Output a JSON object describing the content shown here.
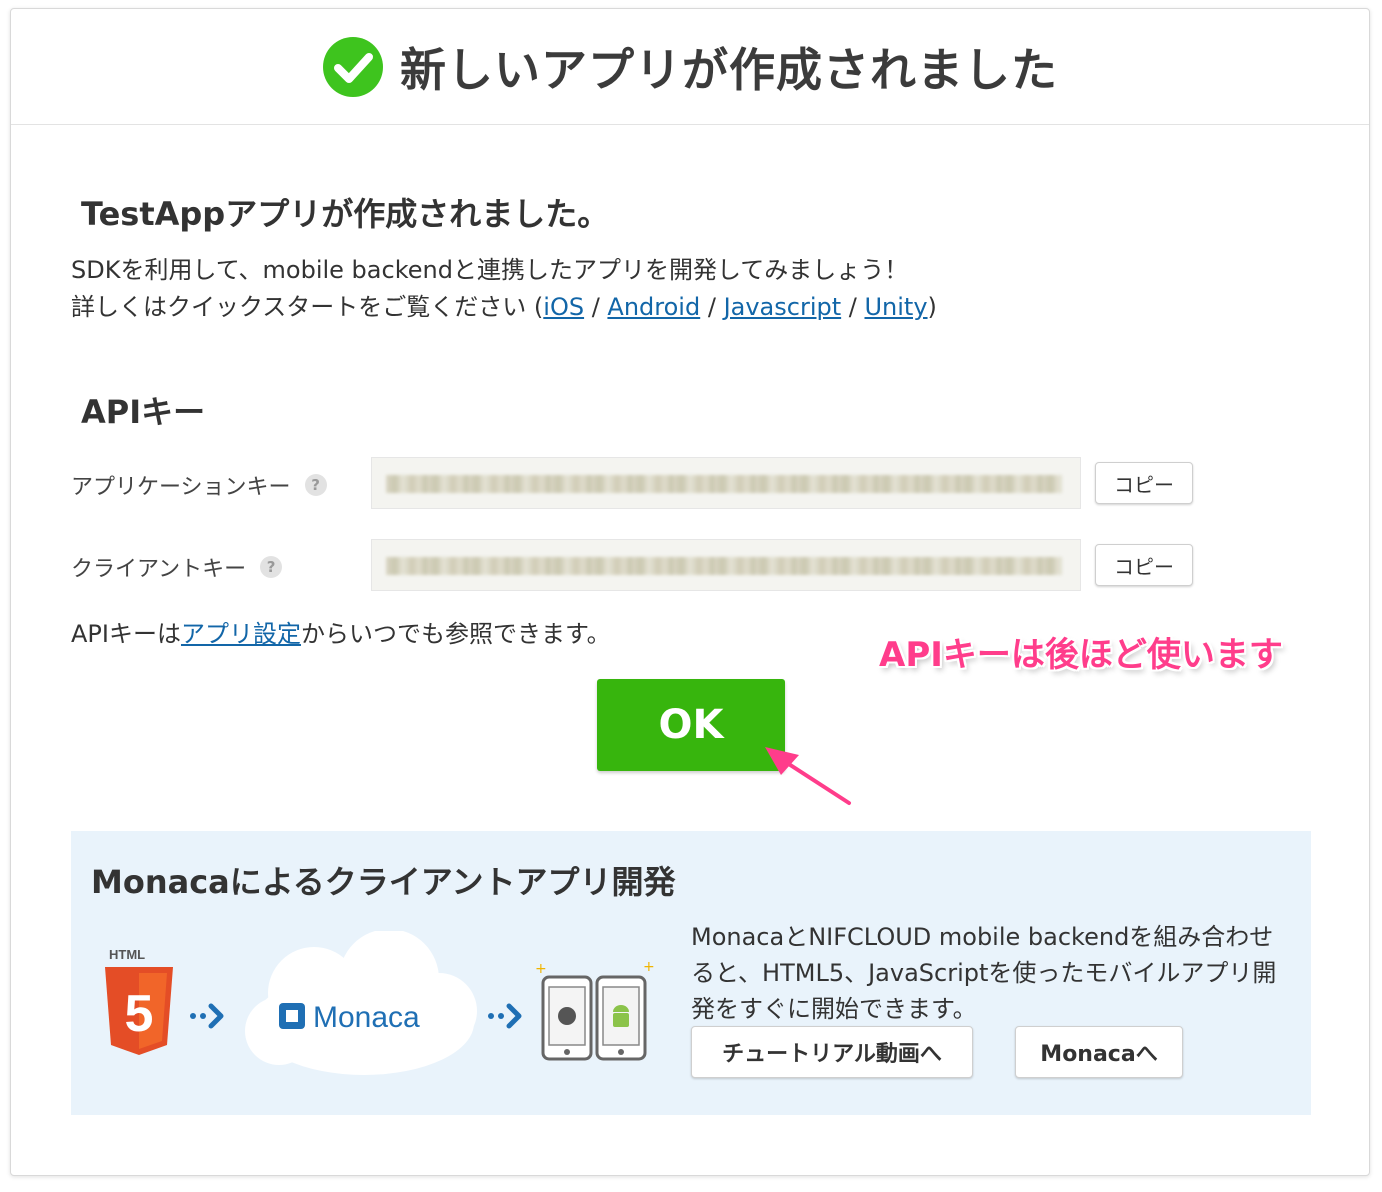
{
  "header": {
    "title": "新しいアプリが作成されました"
  },
  "created": {
    "title": "TestAppアプリが作成されました。",
    "line1": "SDKを利用して、mobile backendと連携したアプリを開発してみましょう！",
    "line2_prefix": "詳しくはクイックスタートをご覧ください (",
    "links": [
      "iOS",
      "Android",
      "Javascript",
      "Unity"
    ],
    "separator": " / ",
    "line2_suffix": ")"
  },
  "api": {
    "title": "APIキー",
    "application_key_label": "アプリケーションキー",
    "client_key_label": "クライアントキー",
    "help": "?",
    "copy_label": "コピー",
    "note_prefix": "APIキーは",
    "note_link": "アプリ設定",
    "note_suffix": "からいつでも参照できます。"
  },
  "annotation": {
    "text": "APIキーは後ほど使います",
    "color": "#ff3d8b"
  },
  "ok_button": {
    "label": "OK",
    "color": "#37b50d"
  },
  "monaca": {
    "title": "Monacaによるクライアントアプリ開発",
    "description": "MonacaとNIFCLOUD mobile backendを組み合わせると、HTML5、JavaScriptを使ったモバイルアプリ開発をすぐに開始できます。",
    "tutorial_button": "チュートリアル動画へ",
    "monaca_button": "Monacaへ",
    "graphic": {
      "html_label": "HTML",
      "html_number": "5",
      "cloud_label": "Monaca"
    }
  }
}
